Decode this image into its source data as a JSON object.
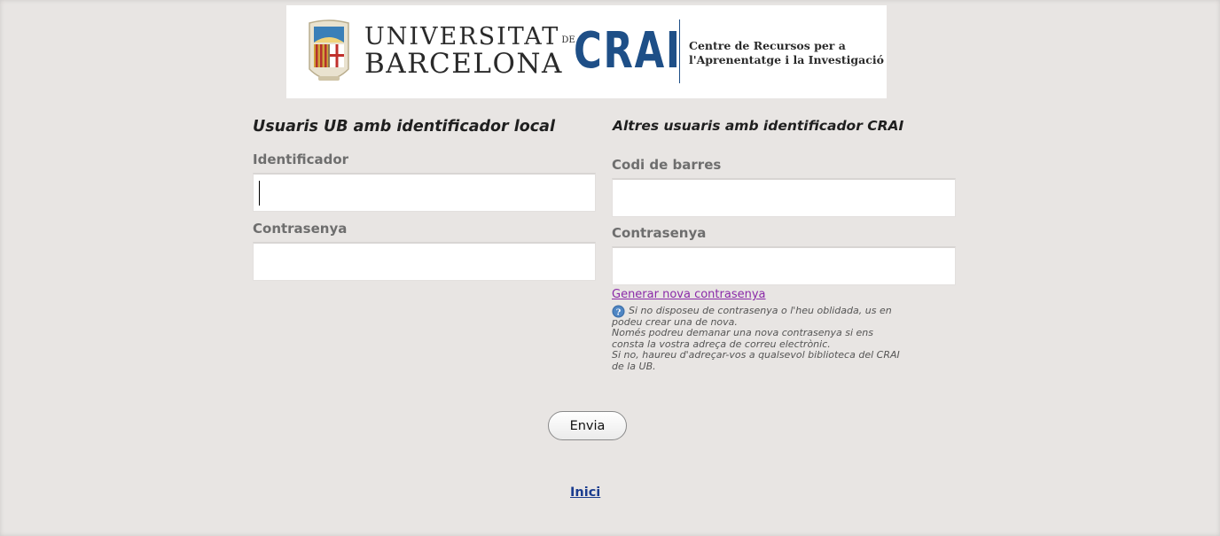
{
  "header": {
    "university_line1": "UNIVERSITAT",
    "university_de": "DE",
    "university_line2": "BARCELONA",
    "crai_logo_text": "CRAI",
    "crai_desc_line1": "Centre de Recursos per a",
    "crai_desc_line2": "l'Aprenentatge i la Investigació",
    "crest_icon": "university-crest-icon"
  },
  "left_form": {
    "title": "Usuaris UB amb identificador local",
    "identifier_label": "Identificador",
    "identifier_value": "",
    "password_label": "Contrasenya",
    "password_value": ""
  },
  "right_form": {
    "title": "Altres usuaris amb identificador CRAI",
    "barcode_label": "Codi de barres",
    "barcode_value": "",
    "password_label": "Contrasenya",
    "password_value": "",
    "generate_link": "Generar nova contrasenya",
    "help_icon": "info-icon",
    "help_lines": [
      "Si no disposeu de contrasenya o l'heu oblidada, us en",
      "podeu crear una de nova.",
      "Només podreu demanar una nova contrasenya si ens",
      "consta la vostra adreça de correu electrònic.",
      "Si no, haureu d'adreçar-vos a qualsevol biblioteca del CRAI",
      "de la UB."
    ]
  },
  "actions": {
    "submit_label": "Envia",
    "home_link": "Inici"
  },
  "colors": {
    "background": "#e8e5e3",
    "crai_blue": "#1e4f87",
    "link_purple": "#8a2aa8",
    "link_blue": "#1b3d8f"
  }
}
